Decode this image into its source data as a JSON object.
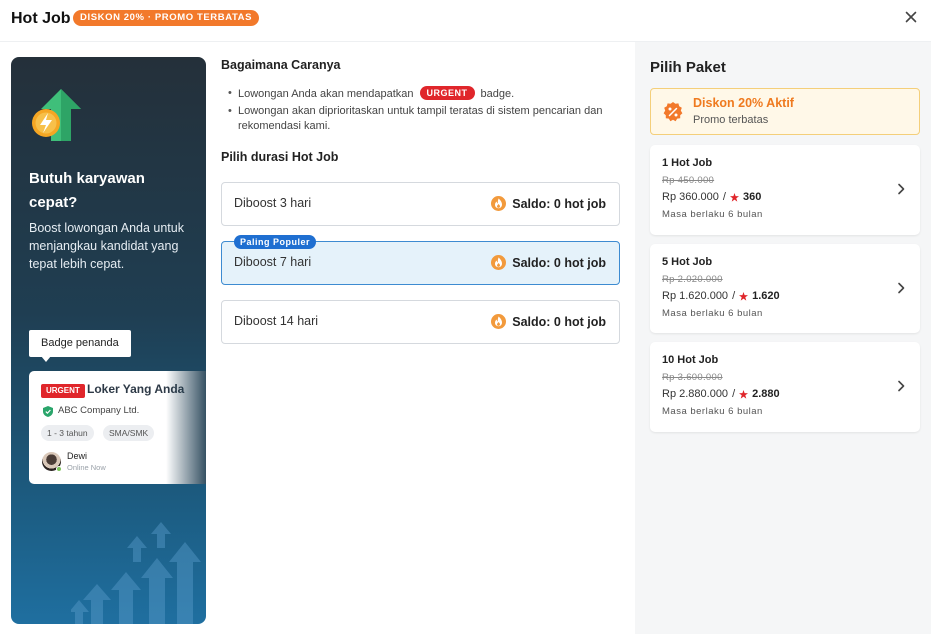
{
  "header": {
    "title": "Hot Job",
    "promo_pill": "DISKON 20% · PROMO TERBATAS"
  },
  "promo_card": {
    "heading": "Butuh karyawan cepat?",
    "description": "Boost lowongan Anda untuk menjangkau kandidat yang tepat lebih cepat.",
    "badge_tooltip": "Badge penanda",
    "sample_job": {
      "urgent": "URGENT",
      "title": "Loker Yang Anda",
      "company": "ABC Company Ltd.",
      "tags": [
        "1 - 3 tahun",
        "SMA/SMK"
      ],
      "recruiter": "Dewi",
      "status": "Online Now"
    }
  },
  "how_to": {
    "title": "Bagaimana Caranya",
    "item1_before": "Lowongan Anda akan mendapatkan",
    "item1_badge": "URGENT",
    "item1_after": "badge.",
    "item2": "Lowongan akan diprioritaskan untuk tampil teratas di sistem pencarian dan rekomendasi kami."
  },
  "durations": {
    "title": "Pilih durasi Hot Job",
    "options": [
      {
        "label": "Diboost 3 hari",
        "saldo": "Saldo: 0 hot job",
        "selected": false
      },
      {
        "label": "Diboost 7 hari",
        "saldo": "Saldo: 0 hot job",
        "selected": true,
        "tag": "Paling Populer"
      },
      {
        "label": "Diboost 14 hari",
        "saldo": "Saldo: 0 hot job",
        "selected": false
      }
    ]
  },
  "packages": {
    "title": "Pilih Paket",
    "discount": {
      "title": "Diskon 20% Aktif",
      "subtitle": "Promo terbatas"
    },
    "items": [
      {
        "name": "1 Hot Job",
        "old_price": "Rp 450.000",
        "price": "Rp 360.000",
        "separator": "/",
        "points": "360",
        "validity": "Masa berlaku 6 bulan"
      },
      {
        "name": "5 Hot Job",
        "old_price": "Rp 2.020.000",
        "price": "Rp 1.620.000",
        "separator": "/",
        "points": "1.620",
        "validity": "Masa berlaku 6 bulan"
      },
      {
        "name": "10 Hot Job",
        "old_price": "Rp 3.600.000",
        "price": "Rp 2.880.000",
        "separator": "/",
        "points": "2.880",
        "validity": "Masa berlaku 6 bulan"
      }
    ]
  },
  "colors": {
    "accent_orange": "#f2792b",
    "urgent_red": "#e0262b",
    "selected_blue": "#3d8bd1",
    "popular_blue": "#1f6fd1"
  },
  "icons": {
    "close": "close-icon",
    "hero": "rocket-arrow-icon",
    "fire": "fire-icon",
    "discount": "percent-badge-icon",
    "star": "star-icon",
    "chevron": "chevron-right-icon"
  }
}
